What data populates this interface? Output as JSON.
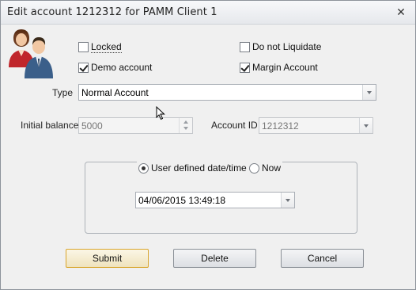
{
  "window": {
    "title": "Edit account 1212312 for PAMM Client 1",
    "close_glyph": "✕"
  },
  "icon": {
    "name": "users-icon",
    "female_color": "#c0262b",
    "male_color": "#3b5f8a"
  },
  "checkboxes": {
    "locked": {
      "label": "Locked",
      "checked": false
    },
    "do_not_liquidate": {
      "label": "Do not Liquidate",
      "checked": false
    },
    "demo_account": {
      "label": "Demo account",
      "checked": true
    },
    "margin_account": {
      "label": "Margin Account",
      "checked": true
    }
  },
  "type": {
    "label": "Type",
    "value": "Normal Account"
  },
  "initial_balance": {
    "label": "Initial balance",
    "value": "5000"
  },
  "account_id": {
    "label": "Account ID",
    "value": "1212312"
  },
  "date_group": {
    "user_defined_label": "User defined date/time",
    "now_label": "Now",
    "selected": "user_defined",
    "datetime_value": "04/06/2015 13:49:18"
  },
  "buttons": {
    "submit": "Submit",
    "delete": "Delete",
    "cancel": "Cancel"
  },
  "colors": {
    "default_button_border": "#d9a52c",
    "window_bg": "#f0f0f0"
  }
}
